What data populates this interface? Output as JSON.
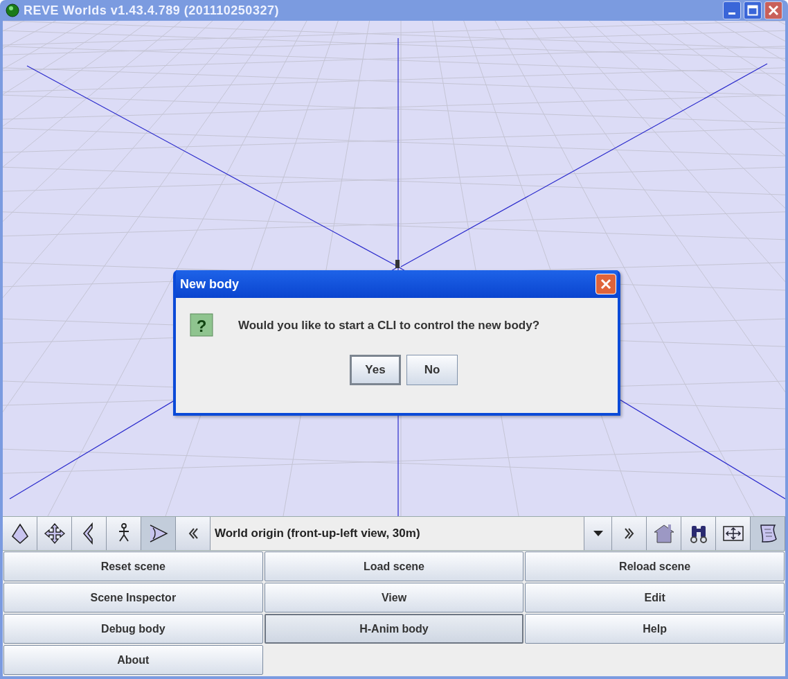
{
  "window": {
    "title": "REVE Worlds v1.43.4.789 (201110250327)"
  },
  "dialog": {
    "title": "New body",
    "icon_glyph": "?",
    "message": "Would you like to start a CLI to control the new body?",
    "buttons": [
      {
        "label": "Yes",
        "default": true
      },
      {
        "label": "No",
        "default": false
      }
    ]
  },
  "toolbar": {
    "left_tools": [
      {
        "selected": false
      },
      {
        "selected": false
      },
      {
        "selected": false
      },
      {
        "selected": false
      },
      {
        "selected": true
      }
    ],
    "view_selector": {
      "value": "World origin (front-up-left view, 30m)"
    },
    "right_tools": [
      {
        "selected": false
      },
      {
        "selected": false
      },
      {
        "selected": false
      },
      {
        "selected": true
      }
    ]
  },
  "buttons": [
    {
      "label": "Reset scene",
      "selected": false
    },
    {
      "label": "Load scene",
      "selected": false
    },
    {
      "label": "Reload scene",
      "selected": false
    },
    {
      "label": "Scene Inspector",
      "selected": false
    },
    {
      "label": "View",
      "selected": false
    },
    {
      "label": "Edit",
      "selected": false
    },
    {
      "label": "Debug body",
      "selected": false
    },
    {
      "label": "H-Anim body",
      "selected": true
    },
    {
      "label": "Help",
      "selected": false
    },
    {
      "label": "About",
      "selected": false
    }
  ]
}
